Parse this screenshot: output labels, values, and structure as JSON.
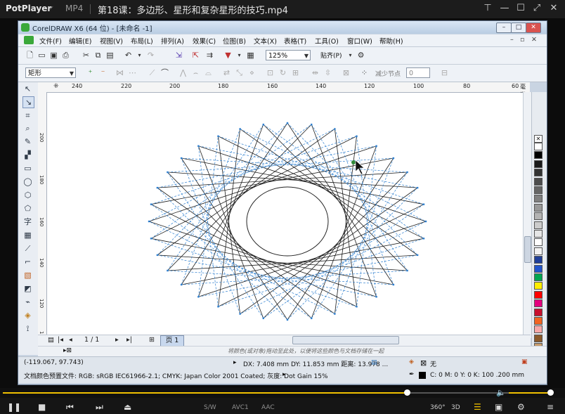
{
  "player": {
    "brand": "PotPlayer",
    "format": "MP4",
    "video_title": "第18课：多边形、星形和复杂星形的技巧.mp4",
    "controls": {
      "pin": "⊤",
      "minimize": "—",
      "maximize": "☐",
      "fullscreen": "⤢",
      "close": "✕"
    },
    "progress": 0.735,
    "volume": 0.92,
    "bottom_labels": [
      "S/W",
      "AVC1",
      "AAC"
    ],
    "bottom_right": [
      "360°",
      "3D"
    ]
  },
  "coreldraw": {
    "title": "CorelDRAW X6 (64 位) - [未命名 -1]",
    "menu": [
      "文件(F)",
      "编辑(E)",
      "视图(V)",
      "布局(L)",
      "排列(A)",
      "效果(C)",
      "位图(B)",
      "文本(X)",
      "表格(T)",
      "工具(O)",
      "窗口(W)",
      "帮助(H)"
    ],
    "zoom": "125%",
    "snap": "贴齐(P)",
    "shape_type": "矩形",
    "reduce_nodes": "减少节点",
    "reduce_value": "0",
    "ruler_top": [
      "240",
      "220",
      "200",
      "180",
      "160",
      "140",
      "120",
      "100",
      "80",
      "60",
      "毫米"
    ],
    "ruler_left": [
      "200",
      "180",
      "160",
      "140",
      "120",
      "100"
    ],
    "page_nav": {
      "count": "1 / 1",
      "tab": "页 1"
    },
    "hint": "将颜色(或对象)拖动至此处，以便将这些颜色与文档存储在一起",
    "status": {
      "cursor": "(-119.067, 97.743)",
      "dx": "DX: 7.408 mm DY: 11.853 mm 距离: 13.978 ...",
      "fill_label": "无",
      "color_profile": "文档颜色预置文件: RGB: sRGB IEC61966-2.1; CMYK: Japan Color 2001 Coated; 灰度: Dot Gain 15%",
      "outline": "C: 0 M: 0 Y: 0 K: 100 .200 mm"
    },
    "palette": [
      "#ffffff",
      "#000000",
      "#1a1a1a",
      "#333333",
      "#4d4d4d",
      "#666666",
      "#808080",
      "#999999",
      "#b3b3b3",
      "#cccccc",
      "#e6e6e6",
      "#ffffff",
      "#f2f2f2",
      "#1f3f99",
      "#2255cc",
      "#00a651",
      "#ffed00",
      "#ff0000",
      "#e4007f",
      "#c8102e",
      "#f26522",
      "#f7a8a8",
      "#8b5a2b",
      "#c89b6b",
      "#b3c7e6",
      "#6fa0dc"
    ]
  }
}
